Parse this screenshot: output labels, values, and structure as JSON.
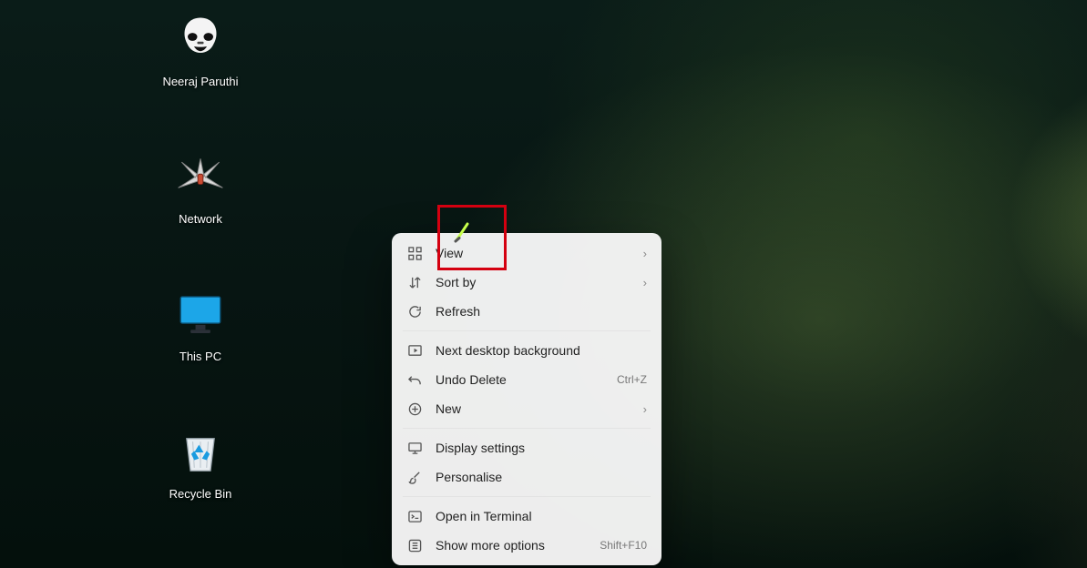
{
  "desktop_icons": [
    {
      "name": "user-folder",
      "icon": "stormtrooper-icon",
      "label": "Neeraj Paruthi"
    },
    {
      "name": "network",
      "icon": "xwing-icon",
      "label": "Network"
    },
    {
      "name": "this-pc",
      "icon": "monitor-icon",
      "label": "This PC"
    },
    {
      "name": "recycle-bin",
      "icon": "recycle-bin-icon",
      "label": "Recycle Bin"
    }
  ],
  "context_menu": {
    "groups": [
      [
        {
          "id": "view",
          "label": "View",
          "icon": "grid-icon",
          "submenu": true
        },
        {
          "id": "sortby",
          "label": "Sort by",
          "icon": "sort-icon",
          "submenu": true
        },
        {
          "id": "refresh",
          "label": "Refresh",
          "icon": "refresh-icon"
        }
      ],
      [
        {
          "id": "next-bg",
          "label": "Next desktop background",
          "icon": "next-bg-icon"
        },
        {
          "id": "undo-delete",
          "label": "Undo Delete",
          "icon": "undo-icon",
          "hint": "Ctrl+Z"
        },
        {
          "id": "new",
          "label": "New",
          "icon": "plus-circle-icon",
          "submenu": true
        }
      ],
      [
        {
          "id": "display-settings",
          "label": "Display settings",
          "icon": "display-settings-icon"
        },
        {
          "id": "personalise",
          "label": "Personalise",
          "icon": "brush-icon"
        }
      ],
      [
        {
          "id": "open-terminal",
          "label": "Open in Terminal",
          "icon": "terminal-icon"
        },
        {
          "id": "more-options",
          "label": "Show more options",
          "icon": "more-options-icon",
          "hint": "Shift+F10"
        }
      ]
    ]
  },
  "chevron_glyph": "›"
}
